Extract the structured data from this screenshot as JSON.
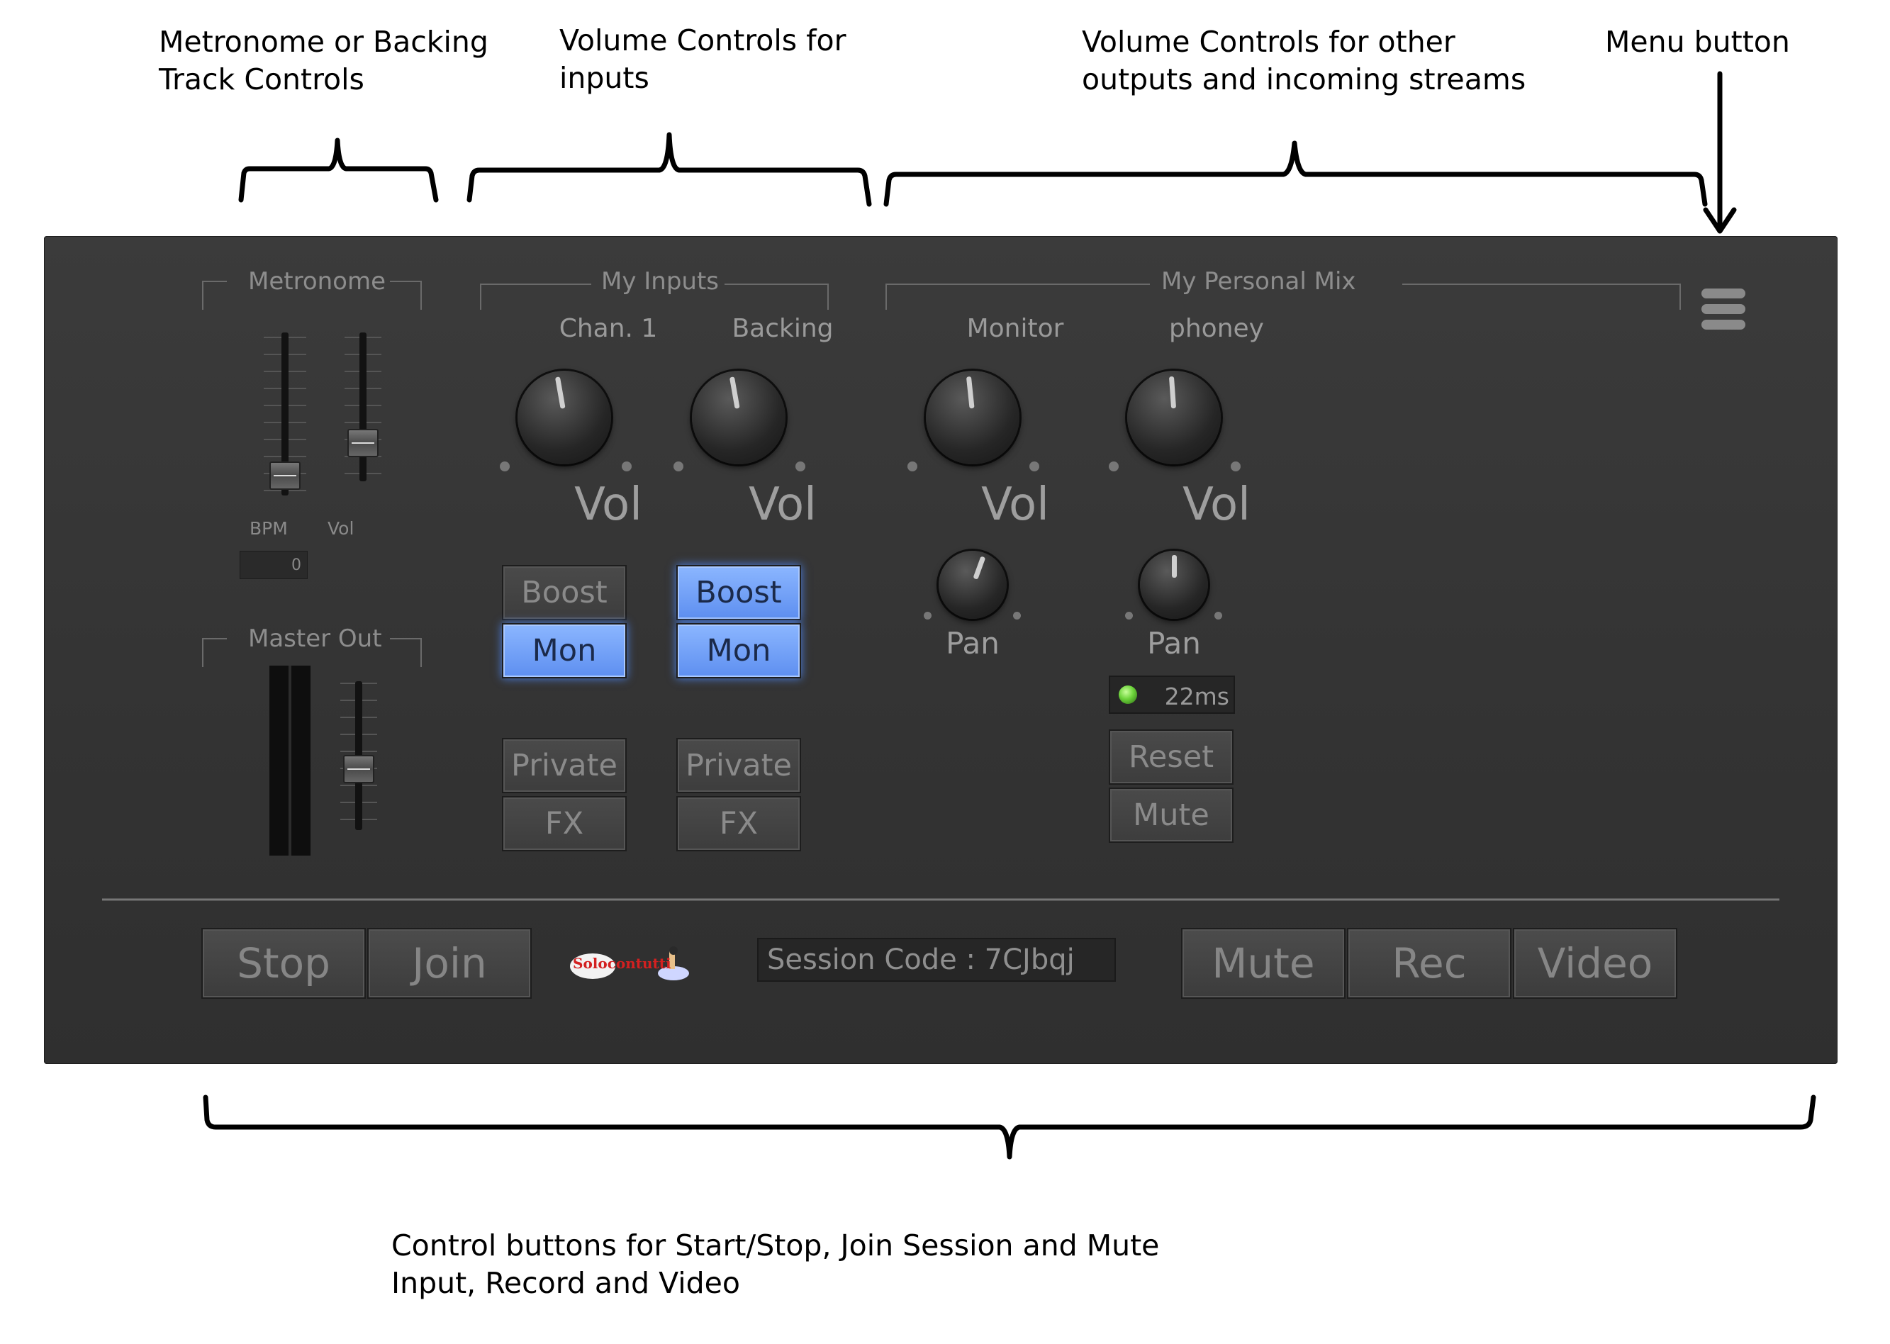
{
  "annotations": {
    "metronome": "Metronome or Backing\nTrack Controls",
    "inputs": "Volume Controls for\ninputs",
    "outputs": "Volume Controls for other\noutputs and incoming streams",
    "menu": "Menu button",
    "control": "Control buttons for Start/Stop, Join Session and Mute\nInput, Record and Video"
  },
  "groups": {
    "metronome": "Metronome",
    "master": "Master Out",
    "inputs": "My Inputs",
    "mix": "My Personal Mix"
  },
  "metronome": {
    "bpm_label": "BPM",
    "vol_label": "Vol",
    "bpm_value": "0"
  },
  "inputs": [
    {
      "name": "Chan. 1",
      "vol": "Vol",
      "boost": "Boost",
      "mon": "Mon",
      "private": "Private",
      "fx": "FX",
      "boost_on": false,
      "mon_on": true
    },
    {
      "name": "Backing",
      "vol": "Vol",
      "boost": "Boost",
      "mon": "Mon",
      "private": "Private",
      "fx": "FX",
      "boost_on": true,
      "mon_on": true
    }
  ],
  "mix": [
    {
      "name": "Monitor",
      "vol": "Vol",
      "pan": "Pan"
    },
    {
      "name": "phoney",
      "vol": "Vol",
      "pan": "Pan",
      "latency": "22ms",
      "reset": "Reset",
      "mute": "Mute"
    }
  ],
  "bottom": {
    "stop": "Stop",
    "join": "Join",
    "session_code": "Session Code : 7CJbqj",
    "mute": "Mute",
    "rec": "Rec",
    "video": "Video",
    "logo_text": "Solocontutti"
  },
  "colors": {
    "panel": "#353535",
    "active": "#6f9cf6",
    "led": "#6cd33a"
  },
  "icons": {
    "menu": "hamburger-icon",
    "led": "status-led-icon"
  }
}
